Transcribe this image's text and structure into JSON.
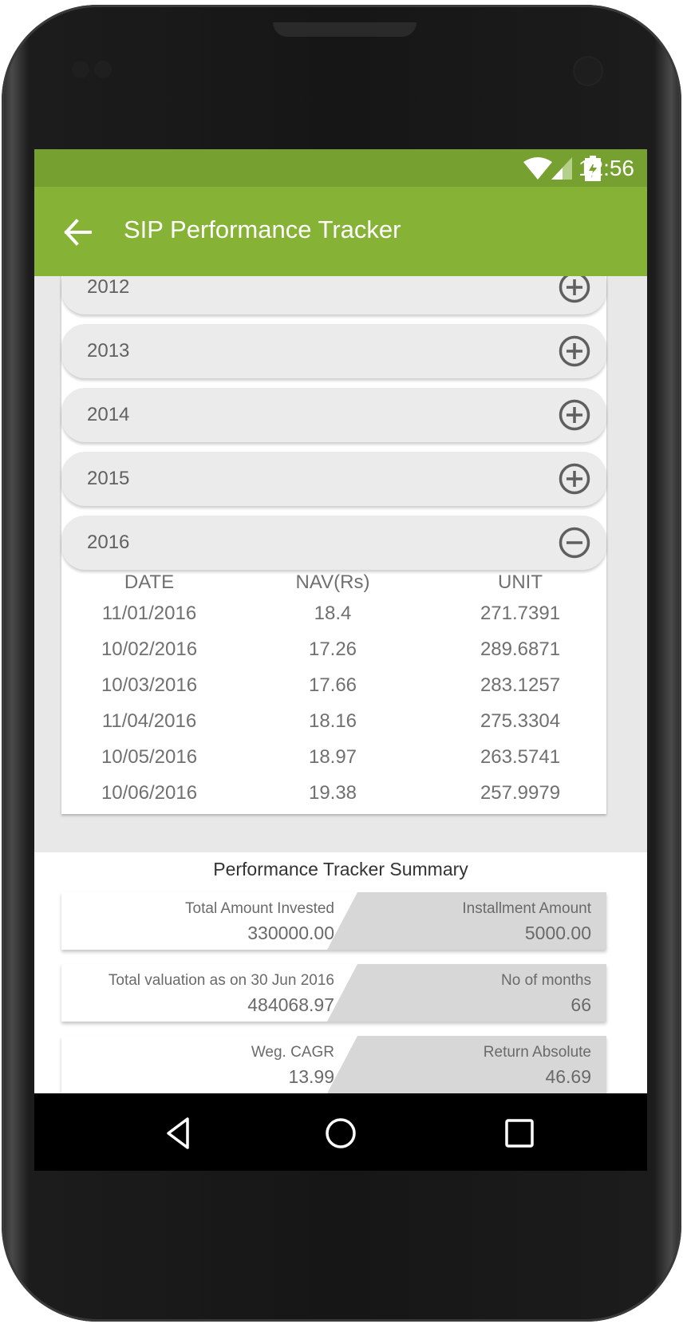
{
  "status_bar": {
    "time": "12:56",
    "icons": [
      "wifi-icon",
      "cell-signal-icon",
      "battery-charging-icon"
    ]
  },
  "app_bar": {
    "title": "SIP Performance Tracker",
    "back_icon": "arrow-left-icon"
  },
  "years": [
    {
      "label": "2012",
      "expanded": false,
      "icon": "plus-circle-icon"
    },
    {
      "label": "2013",
      "expanded": false,
      "icon": "plus-circle-icon"
    },
    {
      "label": "2014",
      "expanded": false,
      "icon": "plus-circle-icon"
    },
    {
      "label": "2015",
      "expanded": false,
      "icon": "plus-circle-icon"
    },
    {
      "label": "2016",
      "expanded": true,
      "icon": "minus-circle-icon"
    }
  ],
  "table": {
    "headers": [
      "DATE",
      "NAV(Rs)",
      "UNIT"
    ],
    "rows": [
      [
        "11/01/2016",
        "18.4",
        "271.7391"
      ],
      [
        "10/02/2016",
        "17.26",
        "289.6871"
      ],
      [
        "10/03/2016",
        "17.66",
        "283.1257"
      ],
      [
        "11/04/2016",
        "18.16",
        "275.3304"
      ],
      [
        "10/05/2016",
        "18.97",
        "263.5741"
      ],
      [
        "10/06/2016",
        "19.38",
        "257.9979"
      ]
    ]
  },
  "summary": {
    "title": "Performance Tracker Summary",
    "cards": [
      {
        "left_label": "Total Amount Invested",
        "left_value": "330000.00",
        "right_label": "Installment Amount",
        "right_value": "5000.00"
      },
      {
        "left_label": "Total valuation as on 30 Jun 2016",
        "left_value": "484068.97",
        "right_label": "No of months",
        "right_value": "66"
      },
      {
        "left_label": "Weg. CAGR",
        "left_value": "13.99",
        "right_label": "Return Absolute",
        "right_value": "46.69"
      }
    ]
  },
  "nav_bar": {
    "buttons": [
      "back-triangle-icon",
      "home-circle-icon",
      "recents-square-icon"
    ]
  },
  "colors": {
    "status_bar": "#76a02f",
    "app_bar": "#86b335",
    "year_row_bg": "#ebebeb",
    "summary_right_bg": "#d7d7d7"
  }
}
